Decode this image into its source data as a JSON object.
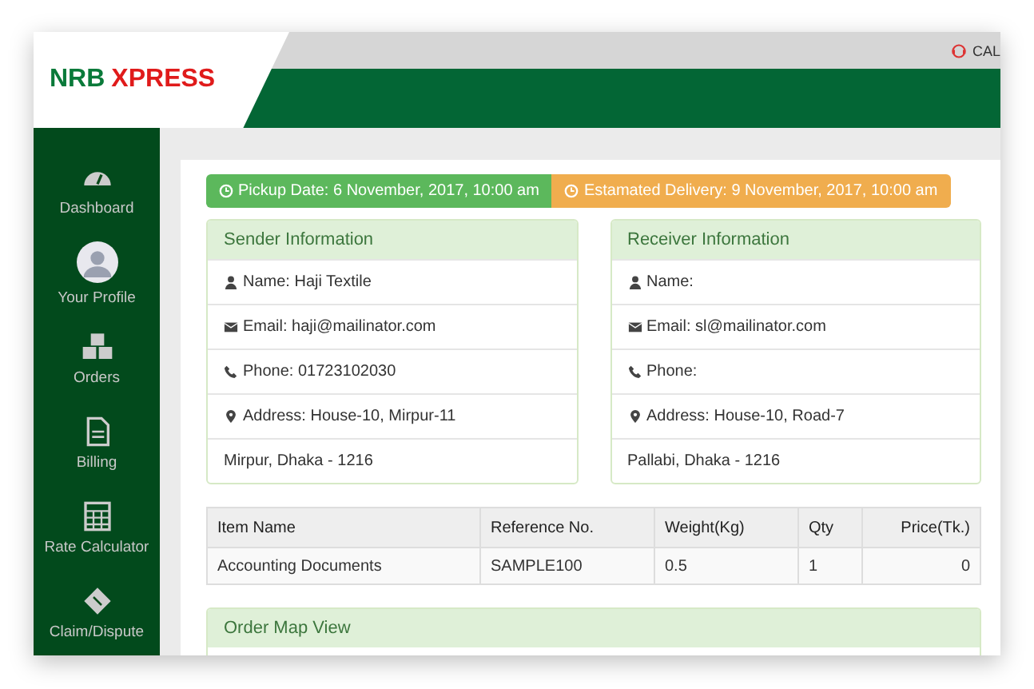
{
  "topbar": {
    "call_label": "CAL"
  },
  "logo": {
    "part_1": "NRB",
    "part_2": "XPRESS"
  },
  "sidebar": {
    "items": [
      {
        "kind": "dashboard",
        "label": "Dashboard"
      },
      {
        "kind": "profile",
        "label": "Your Profile"
      },
      {
        "kind": "orders",
        "label": "Orders"
      },
      {
        "kind": "billing",
        "label": "Billing"
      },
      {
        "kind": "calculator",
        "label": "Rate Calculator"
      },
      {
        "kind": "claim",
        "label": "Claim/Dispute"
      }
    ]
  },
  "dates": [
    {
      "kind": "success",
      "text": "Pickup Date: 6 November, 2017, 10:00 am"
    },
    {
      "kind": "warning",
      "text": "Estamated Delivery: 9 November, 2017, 10:00 am"
    }
  ],
  "panels": [
    {
      "title": "Sender Information",
      "rows": [
        {
          "kind": "name",
          "text": "Name: Haji Textile"
        },
        {
          "kind": "email",
          "text": "Email: haji@mailinator.com"
        },
        {
          "kind": "phone",
          "text": "Phone: 01723102030"
        },
        {
          "kind": "address",
          "text": "Address: House-10, Mirpur-11"
        },
        {
          "kind": "plain",
          "text": "Mirpur, Dhaka - 1216"
        }
      ]
    },
    {
      "title": "Receiver Information",
      "rows": [
        {
          "kind": "name",
          "text": "Name:"
        },
        {
          "kind": "email",
          "text": "Email: sl@mailinator.com"
        },
        {
          "kind": "phone",
          "text": "Phone:"
        },
        {
          "kind": "address",
          "text": "Address: House-10, Road-7"
        },
        {
          "kind": "plain",
          "text": "Pallabi, Dhaka - 1216"
        }
      ]
    }
  ],
  "table": {
    "columns": [
      "Item Name",
      "Reference No.",
      "Weight(Kg)",
      "Qty",
      "Price(Tk.)"
    ],
    "rows": [
      [
        "Accounting Documents",
        "SAMPLE100",
        "0.5",
        "1",
        "0"
      ]
    ]
  },
  "map_panel": {
    "title": "Order Map View"
  }
}
